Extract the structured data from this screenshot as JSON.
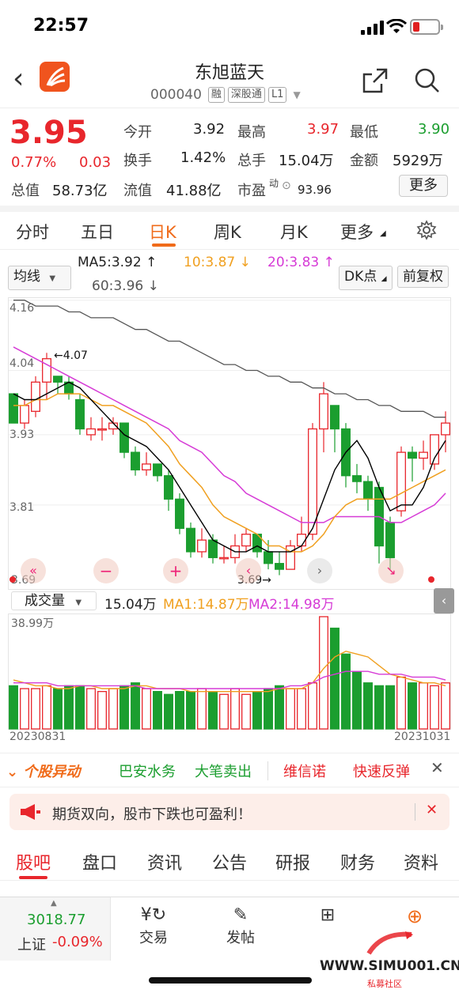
{
  "status_bar": {
    "time": "22:57"
  },
  "header": {
    "stock_name": "东旭蓝天",
    "stock_code": "000040",
    "tags": [
      "融",
      "深股通",
      "L1"
    ]
  },
  "quote": {
    "price": "3.95",
    "change_pct": "0.77%",
    "change": "0.03",
    "open_label": "今开",
    "open": "3.92",
    "high_label": "最高",
    "high": "3.97",
    "low_label": "最低",
    "low": "3.90",
    "turnover_label": "换手",
    "turnover": "1.42%",
    "volume_label": "总手",
    "volume": "15.04万",
    "amount_label": "金额",
    "amount": "5929万",
    "mktcap_label": "总值",
    "mktcap": "58.73亿",
    "float_label": "流值",
    "float_cap": "41.88亿",
    "pe_label": "市盈",
    "pe_sup": "动",
    "pe": "93.96",
    "more_label": "更多"
  },
  "period_tabs": [
    {
      "label": "分时"
    },
    {
      "label": "五日"
    },
    {
      "label": "日K"
    },
    {
      "label": "周K"
    },
    {
      "label": "月K"
    },
    {
      "label": "更多"
    }
  ],
  "ma_row": {
    "selector": "均线",
    "ma5": "MA5:3.92",
    "ma10": "10:3.87",
    "ma20": "20:3.83",
    "ma60": "60:3.96",
    "dk_button": "DK点",
    "adjust_button": "前复权"
  },
  "chart_data": {
    "type": "candlestick",
    "y_ticks": [
      "4.16",
      "4.04",
      "3.93",
      "3.81"
    ],
    "y_bottom_label": "3.69",
    "ylim": [
      3.67,
      4.16
    ],
    "high_annotation": "4.07",
    "low_annotation": "3.69",
    "x_start": "20230831",
    "x_end": "20231031",
    "candles": [
      [
        4.0,
        3.95,
        4.0,
        3.95
      ],
      [
        3.95,
        3.98,
        3.99,
        3.94
      ],
      [
        3.97,
        4.02,
        4.03,
        3.96
      ],
      [
        4.02,
        4.06,
        4.07,
        3.99
      ],
      [
        4.03,
        4.02,
        4.03,
        4.0
      ],
      [
        4.02,
        4.0,
        4.03,
        3.99
      ],
      [
        3.99,
        3.94,
        4.0,
        3.93
      ],
      [
        3.93,
        3.94,
        3.96,
        3.92
      ],
      [
        3.94,
        3.94,
        3.96,
        3.92
      ],
      [
        3.94,
        3.95,
        3.96,
        3.93
      ],
      [
        3.95,
        3.9,
        3.95,
        3.89
      ],
      [
        3.9,
        3.87,
        3.91,
        3.86
      ],
      [
        3.87,
        3.88,
        3.9,
        3.86
      ],
      [
        3.88,
        3.86,
        3.88,
        3.85
      ],
      [
        3.86,
        3.82,
        3.87,
        3.8
      ],
      [
        3.82,
        3.77,
        3.83,
        3.76
      ],
      [
        3.77,
        3.73,
        3.78,
        3.72
      ],
      [
        3.73,
        3.75,
        3.77,
        3.72
      ],
      [
        3.75,
        3.72,
        3.76,
        3.71
      ],
      [
        3.72,
        3.72,
        3.74,
        3.71
      ],
      [
        3.72,
        3.74,
        3.76,
        3.71
      ],
      [
        3.74,
        3.76,
        3.77,
        3.73
      ],
      [
        3.76,
        3.73,
        3.76,
        3.72
      ],
      [
        3.73,
        3.71,
        3.75,
        3.7
      ],
      [
        3.71,
        3.7,
        3.73,
        3.69
      ],
      [
        3.7,
        3.74,
        3.75,
        3.7
      ],
      [
        3.74,
        3.76,
        3.79,
        3.73
      ],
      [
        3.76,
        3.94,
        3.95,
        3.75
      ],
      [
        3.94,
        4.0,
        4.02,
        3.9
      ],
      [
        3.98,
        3.94,
        3.98,
        3.9
      ],
      [
        3.94,
        3.86,
        3.95,
        3.84
      ],
      [
        3.86,
        3.85,
        3.88,
        3.83
      ],
      [
        3.85,
        3.82,
        3.86,
        3.8
      ],
      [
        3.84,
        3.74,
        3.85,
        3.71
      ],
      [
        3.78,
        3.72,
        3.79,
        3.7
      ],
      [
        3.8,
        3.9,
        3.91,
        3.79
      ],
      [
        3.9,
        3.89,
        3.91,
        3.85
      ],
      [
        3.89,
        3.9,
        3.92,
        3.87
      ],
      [
        3.88,
        3.93,
        3.93,
        3.87
      ],
      [
        3.93,
        3.95,
        3.97,
        3.9
      ]
    ],
    "ma5": [
      4.0,
      3.99,
      3.99,
      4.0,
      4.01,
      4.02,
      4.01,
      3.99,
      3.97,
      3.95,
      3.93,
      3.92,
      3.91,
      3.89,
      3.87,
      3.84,
      3.81,
      3.78,
      3.75,
      3.74,
      3.73,
      3.73,
      3.74,
      3.73,
      3.73,
      3.73,
      3.74,
      3.77,
      3.82,
      3.87,
      3.9,
      3.92,
      3.89,
      3.84,
      3.8,
      3.81,
      3.81,
      3.84,
      3.89,
      3.92
    ],
    "ma10": [
      3.98,
      3.98,
      3.99,
      3.99,
      4.0,
      4.0,
      4.0,
      3.99,
      3.98,
      3.98,
      3.97,
      3.96,
      3.95,
      3.93,
      3.91,
      3.88,
      3.86,
      3.84,
      3.81,
      3.79,
      3.78,
      3.77,
      3.76,
      3.74,
      3.74,
      3.73,
      3.73,
      3.74,
      3.76,
      3.79,
      3.81,
      3.82,
      3.82,
      3.82,
      3.82,
      3.83,
      3.84,
      3.85,
      3.86,
      3.87
    ],
    "ma20": [
      4.08,
      4.07,
      4.06,
      4.05,
      4.04,
      4.03,
      4.02,
      4.01,
      4.0,
      3.99,
      3.98,
      3.97,
      3.96,
      3.95,
      3.94,
      3.92,
      3.91,
      3.9,
      3.88,
      3.86,
      3.85,
      3.83,
      3.82,
      3.81,
      3.8,
      3.79,
      3.78,
      3.78,
      3.78,
      3.79,
      3.79,
      3.79,
      3.79,
      3.79,
      3.78,
      3.78,
      3.79,
      3.8,
      3.81,
      3.83
    ],
    "ma60": [
      4.16,
      4.16,
      4.15,
      4.15,
      4.15,
      4.14,
      4.14,
      4.13,
      4.13,
      4.13,
      4.12,
      4.11,
      4.11,
      4.1,
      4.09,
      4.09,
      4.08,
      4.07,
      4.06,
      4.05,
      4.05,
      4.04,
      4.04,
      4.03,
      4.03,
      4.02,
      4.02,
      4.01,
      4.01,
      4.0,
      4.0,
      3.99,
      3.99,
      3.98,
      3.98,
      3.97,
      3.97,
      3.97,
      3.96,
      3.96
    ],
    "volume": {
      "label": "成交量",
      "value": "15.04万",
      "ma1": "MA1:14.87万",
      "ma2": "MA2:14.98万",
      "max_label": "38.99万",
      "ymax": 38.99,
      "values": [
        15,
        14,
        14,
        15,
        14,
        15,
        15,
        14,
        13,
        14,
        15,
        16,
        14,
        13,
        12,
        13,
        13,
        14,
        13,
        12,
        14,
        12,
        13,
        14,
        15,
        14,
        14,
        16,
        38.99,
        35,
        26,
        20,
        16,
        15,
        15,
        18,
        16,
        16,
        15,
        16
      ],
      "ma1_values": [
        17,
        16,
        15,
        15,
        14,
        14,
        15,
        15,
        14,
        14,
        14,
        15,
        15,
        14,
        14,
        14,
        13,
        13,
        13,
        13,
        13,
        13,
        13,
        13,
        14,
        14,
        14,
        16,
        21,
        25,
        27,
        26,
        25,
        22,
        19,
        18,
        17,
        16,
        16,
        15
      ],
      "ma2_values": [
        16,
        16,
        16,
        16,
        15,
        15,
        15,
        15,
        15,
        15,
        15,
        15,
        14,
        14,
        14,
        14,
        14,
        14,
        14,
        14,
        14,
        14,
        14,
        14,
        14,
        15,
        15,
        16,
        18,
        19,
        20,
        20,
        20,
        19,
        19,
        19,
        18,
        18,
        18,
        17
      ]
    }
  },
  "alerts": {
    "brand": "个股异动",
    "items": [
      "巴安水务",
      "大笔卖出",
      "维信诺",
      "快速反弹"
    ]
  },
  "promo": {
    "text": "期货双向，股市下跌也可盈利！"
  },
  "bottom_tabs": [
    "股吧",
    "盘口",
    "资讯",
    "公告",
    "研报",
    "财务",
    "资料"
  ],
  "toolbar": {
    "index_value": "3018.77",
    "index_label": "上证",
    "index_change": "-0.09%",
    "trade": "交易",
    "post": "发帖"
  },
  "watermark": {
    "text": "WWW.SIMU001.CN",
    "sub": "私募社区"
  },
  "colors": {
    "up": "#e8262c",
    "down": "#1b9e2f",
    "accent": "#f06b1a",
    "ma5": "#000000",
    "ma10": "#f0a020",
    "ma20": "#d63bd6",
    "ma60": "#555555"
  }
}
